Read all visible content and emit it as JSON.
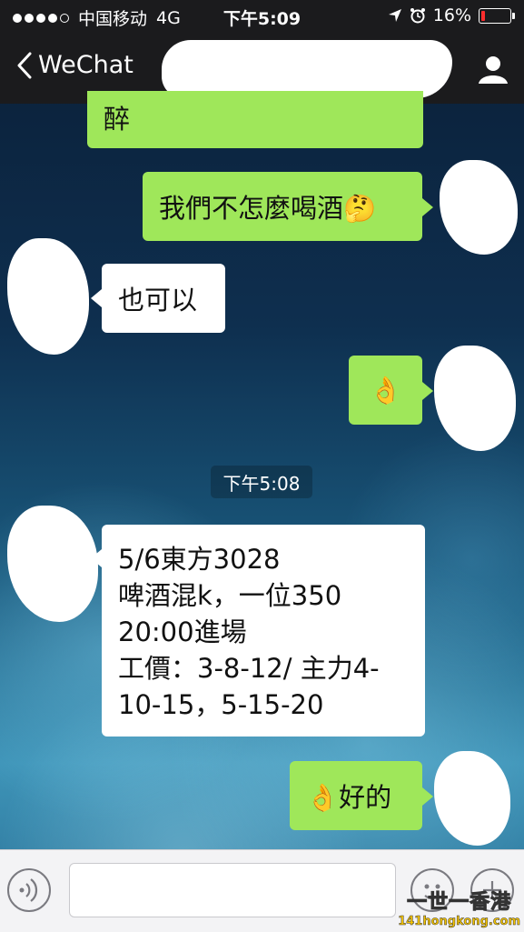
{
  "status_bar": {
    "carrier": "中国移动",
    "network": "4G",
    "time": "下午5:09",
    "battery": "16%",
    "battery_level": 0.16
  },
  "nav": {
    "back_label": "WeChat"
  },
  "messages": [
    {
      "side": "right",
      "text": "醉"
    },
    {
      "side": "right",
      "text": "我們不怎麼喝酒🤔"
    },
    {
      "side": "left",
      "text": "也可以"
    },
    {
      "side": "right",
      "text": "👌"
    },
    {
      "side": "left",
      "text": "5/6東方3028\n啤酒混k，一位350\n20:00進場\n工價：3-8-12/ 主力4-\n10-15，5-15-20"
    },
    {
      "side": "right",
      "text": "👌好的"
    }
  ],
  "timestamp": "下午5:08",
  "watermark": {
    "line1": "一世一香港",
    "line2": "141hongkong.com"
  }
}
